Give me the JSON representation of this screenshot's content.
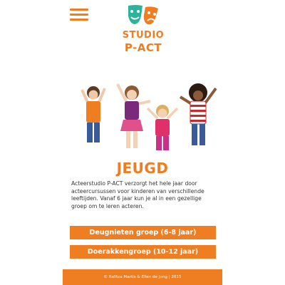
{
  "logo": {
    "line1": "STUDIO",
    "line2": "P-ACT",
    "colors": {
      "orange": "#ef7d22",
      "teal": "#2bb39c"
    }
  },
  "menu": {
    "icon": "hamburger-menu-icon"
  },
  "hero": {
    "image": "children-jumping-photo"
  },
  "page": {
    "title": "JEUGD",
    "intro": "Acteerstudio P-ACT verzorgt het hele jaar door acteercursussen voor kinderen van verschillende leeftijden. Vanaf 6 jaar kun je al in een gezellige groep om te leren acteren."
  },
  "buttons": {
    "group1": "Deugnieten groep (6-8 jaar)",
    "group2": "Doerakkengroep (10-12 jaar)"
  },
  "footer": {
    "copyright": "© Ralitza Martis & Ellen de Jong | 2015"
  },
  "colors": {
    "accent": "#ef7d22",
    "text": "#333333",
    "background": "#ffffff"
  }
}
